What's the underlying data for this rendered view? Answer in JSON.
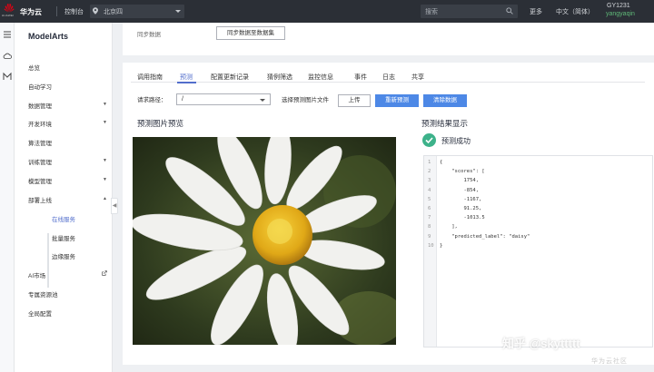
{
  "header": {
    "logo_text": "HUAWEI",
    "brand": "华为云",
    "console": "控制台",
    "region": "北京四",
    "search_placeholder": "搜索",
    "more": "更多",
    "language": "中文（简体）",
    "account": "GY1231",
    "username": "yangyaqin"
  },
  "sidebar": {
    "title": "ModelArts",
    "items": [
      {
        "label": "总览"
      },
      {
        "label": "自动学习"
      },
      {
        "label": "数据管理"
      },
      {
        "label": "开发环境"
      },
      {
        "label": "算法管理"
      },
      {
        "label": "训练管理"
      },
      {
        "label": "模型管理"
      },
      {
        "label": "部署上线"
      },
      {
        "label": "AI市场"
      },
      {
        "label": "专属资源池"
      },
      {
        "label": "全局配置"
      }
    ],
    "sub_items": [
      {
        "label": "在线服务"
      },
      {
        "label": "批量服务"
      },
      {
        "label": "边缘服务"
      }
    ]
  },
  "sync": {
    "label": "同步数据",
    "button": "同步数据至数据集"
  },
  "tabs": [
    "调用指南",
    "预测",
    "配置更新记录",
    "猜例筛选",
    "监控信息",
    "事件",
    "日志",
    "共享"
  ],
  "predict": {
    "path_label": "请求路径：",
    "path_value": "/",
    "file_label": "选择预测图片文件",
    "upload": "上传",
    "predict_btn": "重新预测",
    "demo_btn": "清除数据"
  },
  "preview_title": "预测图片预览",
  "result_title": "预测结果显示",
  "result_status": "预测成功",
  "code_lines": [
    {
      "n": "1",
      "t": "{"
    },
    {
      "n": "2",
      "t": "    \"scores\": ["
    },
    {
      "n": "3",
      "t": "        1754,"
    },
    {
      "n": "4",
      "t": "        -854,"
    },
    {
      "n": "5",
      "t": "        -1167,"
    },
    {
      "n": "6",
      "t": "        91.25,"
    },
    {
      "n": "7",
      "t": "        -1013.5"
    },
    {
      "n": "8",
      "t": "    ],"
    },
    {
      "n": "9",
      "t": "    \"predicted_label\": \"daisy\""
    },
    {
      "n": "10",
      "t": "}"
    }
  ],
  "watermark": "知乎 @skyttttt",
  "watermark2": "华为云社区",
  "colors": {
    "accent": "#526ecc",
    "button_blue": "#4d88e6",
    "success": "#3db28a",
    "topbar": "#2b2f36"
  }
}
